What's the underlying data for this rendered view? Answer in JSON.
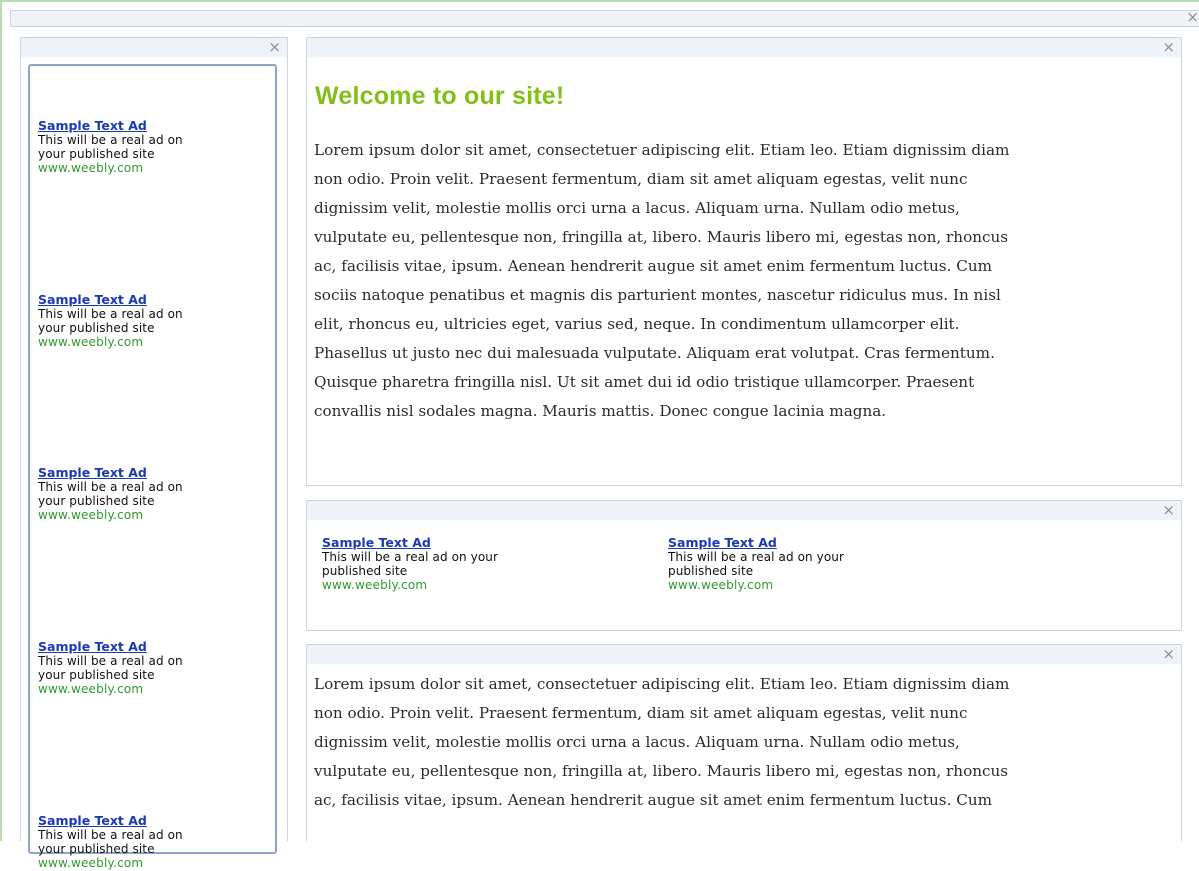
{
  "close_glyph": "×",
  "colors": {
    "title_green": "#84bf17",
    "ad_link_blue": "#1a3ab5",
    "ad_url_green": "#2f9a30",
    "panel_border": "#c9d6e8"
  },
  "sidebar": {
    "ads": [
      {
        "title": "Sample Text Ad",
        "desc_line1": "This will be a real ad on",
        "desc_line2": "your published site",
        "url": "www.weebly.com"
      },
      {
        "title": "Sample Text Ad",
        "desc_line1": "This will be a real ad on",
        "desc_line2": "your published site",
        "url": "www.weebly.com"
      },
      {
        "title": "Sample Text Ad",
        "desc_line1": "This will be a real ad on",
        "desc_line2": "your published site",
        "url": "www.weebly.com"
      },
      {
        "title": "Sample Text Ad",
        "desc_line1": "This will be a real ad on",
        "desc_line2": "your published site",
        "url": "www.weebly.com"
      },
      {
        "title": "Sample Text Ad",
        "desc_line1": "This will be a real ad on",
        "desc_line2": "your published site",
        "url": "www.weebly.com"
      }
    ]
  },
  "main": {
    "title": "Welcome to our site!",
    "paragraph_1_lines": [
      "Lorem ipsum dolor sit amet, consectetuer adipiscing elit. Etiam leo. Etiam dignissim diam",
      "non odio. Proin velit. Praesent fermentum, diam sit amet aliquam egestas, velit nunc",
      "dignissim velit, molestie mollis orci urna a lacus. Aliquam urna. Nullam odio metus,",
      "vulputate eu, pellentesque non, fringilla at, libero. Mauris libero mi, egestas non, rhoncus",
      "ac, facilisis vitae, ipsum. Aenean hendrerit augue sit amet enim fermentum luctus. Cum",
      "sociis natoque penatibus et magnis dis parturient montes, nascetur ridiculus mus. In nisl",
      "elit, rhoncus eu, ultricies eget, varius sed, neque. In condimentum ullamcorper elit.",
      "Phasellus ut justo nec dui malesuada vulputate. Aliquam erat volutpat. Cras fermentum.",
      "Quisque pharetra fringilla nisl. Ut sit amet dui id odio tristique ullamcorper. Praesent",
      "convallis nisl sodales magna. Mauris mattis. Donec congue lacinia magna."
    ],
    "horizontal_ads": [
      {
        "title": "Sample Text Ad",
        "desc_line1": "This will be a real ad on your",
        "desc_line2": "published site",
        "url": "www.weebly.com"
      },
      {
        "title": "Sample Text Ad",
        "desc_line1": "This will be a real ad on your",
        "desc_line2": "published site",
        "url": "www.weebly.com"
      }
    ],
    "paragraph_2_lines": [
      "Lorem ipsum dolor sit amet, consectetuer adipiscing elit. Etiam leo. Etiam dignissim diam",
      "non odio. Proin velit. Praesent fermentum, diam sit amet aliquam egestas, velit nunc",
      "dignissim velit, molestie mollis orci urna a lacus. Aliquam urna. Nullam odio metus,",
      "vulputate eu, pellentesque non, fringilla at, libero. Mauris libero mi, egestas non, rhoncus",
      "ac, facilisis vitae, ipsum. Aenean hendrerit augue sit amet enim fermentum luctus. Cum"
    ]
  }
}
